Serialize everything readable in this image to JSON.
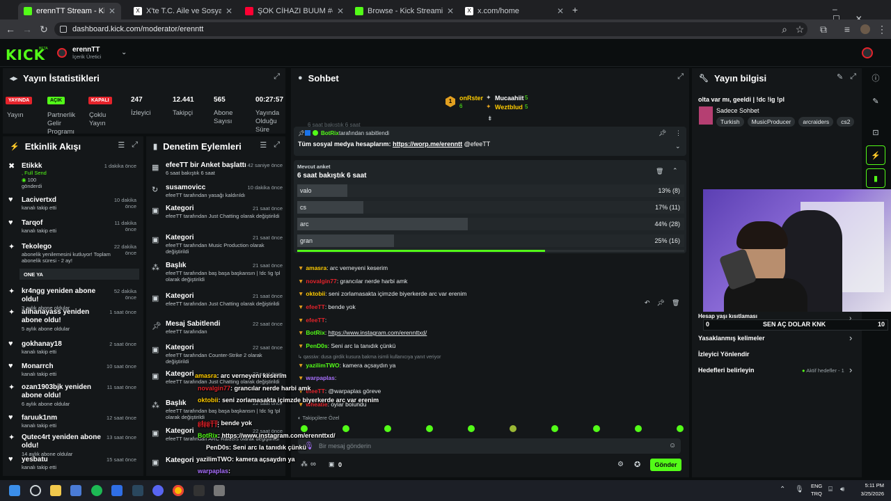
{
  "browser": {
    "tabs": [
      {
        "label": "erennTT Stream - Kick Dashboa",
        "active": true,
        "color": "#53fc18"
      },
      {
        "label": "X'te T.C. Aile ve Sosyal Hizmetle",
        "active": false,
        "color": "#ffffff"
      },
      {
        "label": "ŞOK CİHAZI BUUM #erenntt #k",
        "active": false,
        "color": "#ff0033"
      },
      {
        "label": "Browse - Kick Streaming",
        "active": false,
        "color": "#53fc18"
      },
      {
        "label": "x.com/home",
        "active": false,
        "color": "#ffffff"
      }
    ],
    "new_tab": "+",
    "url": "dashboard.kick.com/moderator/erenntt"
  },
  "header": {
    "logo": "KICK",
    "logo_sup": "BETA",
    "channel_name": "erennTT",
    "channel_role": "İçerik Üretici"
  },
  "stats": {
    "title": "Yayın İstatistikleri",
    "items": [
      {
        "badge": "YAYINDA",
        "badge_color": "#e5232b",
        "label": "Yayın"
      },
      {
        "badge": "AÇIK",
        "badge_color": "#53fc18",
        "label": "Partnerlik Gelir Programı"
      },
      {
        "badge": "KAPALI",
        "badge_color": "#e5232b",
        "label": "Çoklu Yayın"
      },
      {
        "value": "247",
        "label": "İzleyici"
      },
      {
        "value": "12.441",
        "label": "Takipçi"
      },
      {
        "value": "565",
        "label": "Abone Sayısı"
      },
      {
        "value": "00:27:57",
        "label": "Yayında Olduğu Süre"
      }
    ]
  },
  "activity": {
    "title": "Etkinlik Akışı",
    "items": [
      {
        "name": "Etikkk",
        "line2": ", Full Send",
        "line3": "100",
        "line4": "gönderdi",
        "time": "1 dakika önce",
        "icon": "kick-icon"
      },
      {
        "name": "Lacivertxd",
        "sub": "kanalı takip etti",
        "time": "10 dakika önce",
        "icon": "heart-icon"
      },
      {
        "name": "Tarqof",
        "sub": "kanalı takip etti",
        "time": "11 dakika önce",
        "icon": "heart-icon"
      },
      {
        "name": "Tekolego",
        "sub": "abonelik yenilemesini kutluyor! Toplam abonelik süresi - 2 ay!",
        "time": "22 dakika önce",
        "icon": "star-icon",
        "extra": "ONE YA"
      },
      {
        "name": "kr4ngg yeniden abone oldu!",
        "sub": "3 aylık abone oldular",
        "time": "52 dakika önce",
        "icon": "star-icon"
      },
      {
        "name": "alihanayass yeniden abone oldu!",
        "sub": "5 aylık abone oldular",
        "time": "1 saat önce",
        "icon": "star-icon"
      },
      {
        "name": "gokhanay18",
        "sub": "kanalı takip etti",
        "time": "2 saat önce",
        "icon": "heart-icon"
      },
      {
        "name": "Monarrch",
        "sub": "kanalı takip etti",
        "time": "10 saat önce",
        "icon": "heart-icon"
      },
      {
        "name": "ozan1903bjk yeniden abone oldu!",
        "sub": "6 aylık abone oldular",
        "time": "11 saat önce",
        "icon": "star-icon"
      },
      {
        "name": "faruuk1nm",
        "sub": "kanalı takip etti",
        "time": "12 saat önce",
        "icon": "heart-icon"
      },
      {
        "name": "Qutec4rt yeniden abone oldu!",
        "sub": "14 aylık abone oldular",
        "time": "13 saat önce",
        "icon": "star-icon"
      },
      {
        "name": "yesbatu",
        "sub": "kanalı takip etti",
        "time": "15 saat önce",
        "icon": "heart-icon"
      }
    ]
  },
  "moderation": {
    "title": "Denetim Eylemleri",
    "items": [
      {
        "title": "efeeTT bir Anket başlattı",
        "sub": "6 saat bakıştık 6 saat",
        "time": "42 saniye önce"
      },
      {
        "title": "susamovicc",
        "sub": "efeeTT tarafından yasağı kaldırıldı",
        "time": "10 dakika önce"
      },
      {
        "title": "Kategori",
        "sub": "efeeTT tarafından Just Chatting olarak değiştirildi",
        "time": "21 saat önce"
      },
      {
        "title": "Kategori",
        "sub": "efeeTT tarafından Music Production olarak değiştirildi",
        "time": "21 saat önce"
      },
      {
        "title": "Başlık",
        "sub": "efeeTT tarafından baş başa başkansın | !dc !ig !pl olarak değiştirildi",
        "time": "21 saat önce"
      },
      {
        "title": "Kategori",
        "sub": "efeeTT tarafından Just Chatting olarak değiştirildi",
        "time": "21 saat önce"
      },
      {
        "title": "Mesaj Sabitlendi",
        "sub": "efeeTT tarafından",
        "time": "22 saat önce"
      },
      {
        "title": "Kategori",
        "sub": "efeeTT tarafından Counter-Strike 2 olarak değiştirildi",
        "time": "22 saat önce"
      },
      {
        "title": "Kategori",
        "sub": "efeeTT tarafından Just Chatting olarak değiştirildi",
        "time": "22 saat önce"
      },
      {
        "title": "Başlık",
        "sub": "efeeTT tarafından baş başa başkansın | !dc !ig !pl olarak değiştirildi",
        "time": "22 saat önce"
      },
      {
        "title": "Kategori",
        "sub": "efeeTT tarafından ARC Raiders olarak değiştirildi",
        "time": "22 saat önce"
      },
      {
        "title": "Kategori",
        "sub": "",
        "time": "22 saat önce"
      }
    ]
  },
  "chat": {
    "title": "Sohbet",
    "top_gifters": [
      {
        "rank": "1",
        "name": "onRster",
        "count": "6"
      },
      {
        "name": "Mucaahiit",
        "count": "5"
      },
      {
        "name": "Weztblud",
        "count": "5"
      }
    ],
    "pinned": {
      "by": "BotRix",
      "by_label": "tarafından sabitlendi",
      "text": "Tüm sosyal medya hesaplarım:",
      "link": "https://worp.me/erenntt",
      "mention": "@efeeTT",
      "behind_text": "6 saat bakıştık 6 saat"
    },
    "poll": {
      "label": "Mevcut anket",
      "question": "6 saat bakıştık 6 saat",
      "options": [
        {
          "name": "valo",
          "pct": 13,
          "text": "13% (8)"
        },
        {
          "name": "cs",
          "pct": 17,
          "text": "17% (11)"
        },
        {
          "name": "arc",
          "pct": 44,
          "text": "44% (28)"
        },
        {
          "name": "gran",
          "pct": 25,
          "text": "25% (16)"
        }
      ],
      "timer_fraction": 0.64
    },
    "messages": [
      {
        "user": "amasra",
        "color": "#ffcc00",
        "text": ": arc verneyeni keserim"
      },
      {
        "user": "novalgin77",
        "color": "#e5232b",
        "text": ": grancılar nerde harbi amk"
      },
      {
        "user": "oktobii",
        "color": "#ffcc00",
        "text": ": seni zorlamasakta içimzde biyerkerde arc var erenim"
      },
      {
        "user": "efeeTT",
        "color": "#e5232b",
        "text": ": bende yok"
      },
      {
        "user": "efeeTT",
        "color": "#e5232b",
        "text": ":"
      },
      {
        "user": "BotRix",
        "color": "#53fc18",
        "text": ": ",
        "link": "https://www.instagram.com/erennttxd/"
      },
      {
        "user": "PenD0s",
        "color": "#53fc18",
        "text": ": Seni arc la tanıdık çünkü"
      },
      {
        "reply": "qassiw: dusa girdik kusura bakma isimli kullanıcıya yanıt veriyor"
      },
      {
        "user": "yazilimTWO",
        "color": "#53fc18",
        "text": ": kamera açsaydın ya"
      },
      {
        "user": "warpaplas",
        "color": "#a970ff",
        "text": ":"
      },
      {
        "user": "efeeTT",
        "color": "#e5232b",
        "text": ": @warpaplas göreve"
      },
      {
        "user": "wheatie",
        "color": "#e5232b",
        "text": ": oylar bolundu"
      }
    ],
    "followers_only": "Takipçilere Özel",
    "input_placeholder": "Bir mesaj gönderin",
    "infinity": "∞",
    "count": "0",
    "send": "Gönder"
  },
  "info": {
    "title": "Yayın bilgisi",
    "stream_title": "olta var mı, geeldi | !dc !ig !pl",
    "category": "Sadece Sohbet",
    "tags": [
      "Turkish",
      "MusicProducer",
      "arcraiders",
      "cs2"
    ],
    "settings": [
      {
        "label": "Hesap yaşı kısıtlaması"
      },
      {
        "label": "Yasaklanmış kelimeler"
      },
      {
        "label": "İzleyici Yönlendir"
      },
      {
        "label": "Hedefleri belirleyin",
        "value": "Aktif hedefler - 1"
      }
    ],
    "goal_text": "SEN AÇ DOLAR KNK",
    "goal_left": "0",
    "goal_right": "10"
  },
  "overlay": [
    {
      "user": "amasra",
      "color": "#ffcc00",
      "text": ": arc verneyeni keserim"
    },
    {
      "user": "novalgin77",
      "color": "#e5232b",
      "text": ": grancılar nerde harbi amk"
    },
    {
      "user": "oktobii",
      "color": "#ffcc00",
      "text": ": seni zorlamasakta içimzde biyerkerde arc var erenim"
    },
    {
      "user": "efeeTT",
      "color": "#e5232b",
      "text": ": bende yok"
    },
    {
      "user": "efeeTT",
      "color": "#e5232b",
      "text": ":"
    },
    {
      "user": "BotRix",
      "color": "#53fc18",
      "text": ": https://www.instagram.com/erennttxd/"
    },
    {
      "user": "PenD0s",
      "color": "#ffffff",
      "text": ": Seni arc la tanıdık çünkü"
    },
    {
      "user": "yazilimTWO",
      "color": "#ffffff",
      "text": ": kamera açsaydın ya"
    },
    {
      "user": "warpaplas",
      "color": "#a970ff",
      "text": ":"
    },
    {
      "user": "efeeTT",
      "color": "#e5232b",
      "text": ": @warpaplas göreve"
    },
    {
      "user": "wheatie",
      "color": "#e5232b",
      "text": ": oylar bolundu"
    }
  ],
  "taskbar": {
    "lang1": "ENG",
    "lang2": "TRQ",
    "time": "5:11 PM",
    "date": "3/25/2026"
  },
  "colors": {
    "accent": "#53fc18",
    "live": "#e5232b",
    "bg": "#0b0e0f",
    "panel": "#141719"
  }
}
